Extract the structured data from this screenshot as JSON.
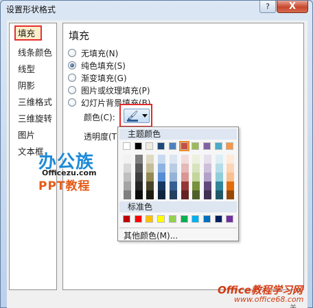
{
  "window": {
    "title": "设置形状格式",
    "help_label": "?",
    "close_label": "X"
  },
  "nav": {
    "items": [
      {
        "label": "填充",
        "selected": true
      },
      {
        "label": "线条颜色"
      },
      {
        "label": "线型"
      },
      {
        "label": "阴影"
      },
      {
        "label": "三维格式"
      },
      {
        "label": "三维旋转"
      },
      {
        "label": "图片"
      },
      {
        "label": "文本框"
      }
    ]
  },
  "panel": {
    "title": "填充",
    "options": [
      {
        "label": "无填充(N)",
        "checked": false
      },
      {
        "label": "纯色填充(S)",
        "checked": true
      },
      {
        "label": "渐变填充(G)",
        "checked": false
      },
      {
        "label": "图片或纹理填充(P)",
        "checked": false
      },
      {
        "label": "幻灯片背景填充(B)",
        "checked": false
      }
    ],
    "color_label": "颜色(C):",
    "transparency_label": "透明度(T):",
    "color_button_icon": "paint-bucket-icon"
  },
  "color_popup": {
    "theme_header": "主题颜色",
    "standard_header": "标准色",
    "more_colors_label": "其他颜色(M)...",
    "selected_theme_index": 5,
    "theme_colors": [
      "#ffffff",
      "#000000",
      "#eeece1",
      "#1f497d",
      "#4f81bd",
      "#c0504d",
      "#9bbb59",
      "#8064a2",
      "#4bacc6",
      "#f79646"
    ],
    "theme_tints": [
      [
        "#f2f2f2",
        "#d8d8d8",
        "#bfbfbf",
        "#a5a5a5",
        "#7f7f7f"
      ],
      [
        "#7f7f7f",
        "#595959",
        "#3f3f3f",
        "#262626",
        "#0c0c0c"
      ],
      [
        "#ddd9c3",
        "#c4bd97",
        "#938953",
        "#494429",
        "#1d1b10"
      ],
      [
        "#c6d9f0",
        "#8db3e2",
        "#548dd4",
        "#17365d",
        "#0f243e"
      ],
      [
        "#dbe5f1",
        "#b8cce4",
        "#95b3d7",
        "#366092",
        "#244061"
      ],
      [
        "#f2dcdb",
        "#e5b9b7",
        "#d99694",
        "#953734",
        "#632423"
      ],
      [
        "#ebf1dd",
        "#d7e3bc",
        "#c3d69b",
        "#76923c",
        "#4f6128"
      ],
      [
        "#e5e0ec",
        "#ccc1d9",
        "#b2a2c7",
        "#5f497a",
        "#3f3151"
      ],
      [
        "#dbeef3",
        "#b7dde8",
        "#92cddc",
        "#31859b",
        "#205867"
      ],
      [
        "#fdeada",
        "#fbd5b5",
        "#fac08f",
        "#e36c09",
        "#974806"
      ]
    ],
    "standard_colors": [
      "#c00000",
      "#ff0000",
      "#ffc000",
      "#ffff00",
      "#92d050",
      "#00b050",
      "#00b0f0",
      "#0070c0",
      "#002060",
      "#7030a0"
    ]
  },
  "watermarks": {
    "logo_text": "办公族",
    "logo_url": "Officezu.com",
    "ppt_text": "PPT教程",
    "site_text": "Office教程学习网",
    "site_url": "www.office68.com"
  },
  "footer_fragment": "关"
}
